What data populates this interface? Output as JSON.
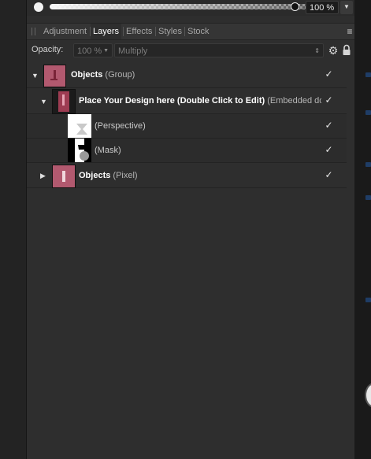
{
  "top_slider": {
    "percent_value": "100 %",
    "slider_level": 0.9
  },
  "tabs": [
    {
      "label": "Adjustment",
      "active": false
    },
    {
      "label": "Layers",
      "active": true
    },
    {
      "label": "Effects",
      "active": false
    },
    {
      "label": "Styles",
      "active": false
    },
    {
      "label": "Stock",
      "active": false
    }
  ],
  "opacity_row": {
    "label": "Opacity:",
    "opacity_value": "100 %",
    "blend_mode": "Multiply"
  },
  "layers": [
    {
      "name": "Objects",
      "type": "(Group)",
      "expanded": true,
      "visible": true
    },
    {
      "name": "Place Your Design here (Double Click to Edit)",
      "type": "(Embedded do",
      "expanded": true,
      "visible": true
    },
    {
      "name": "(Perspective)",
      "visible": true
    },
    {
      "name": "(Mask)",
      "visible": true
    },
    {
      "name": "Objects",
      "type": "(Pixel)",
      "expanded": false,
      "visible": true
    }
  ],
  "icons": {
    "expanded": "triangle-down",
    "collapsed": "triangle-right",
    "visible": "checkmark",
    "panel_menu": "hamburger",
    "settings": "gear",
    "lock": "padlock"
  }
}
